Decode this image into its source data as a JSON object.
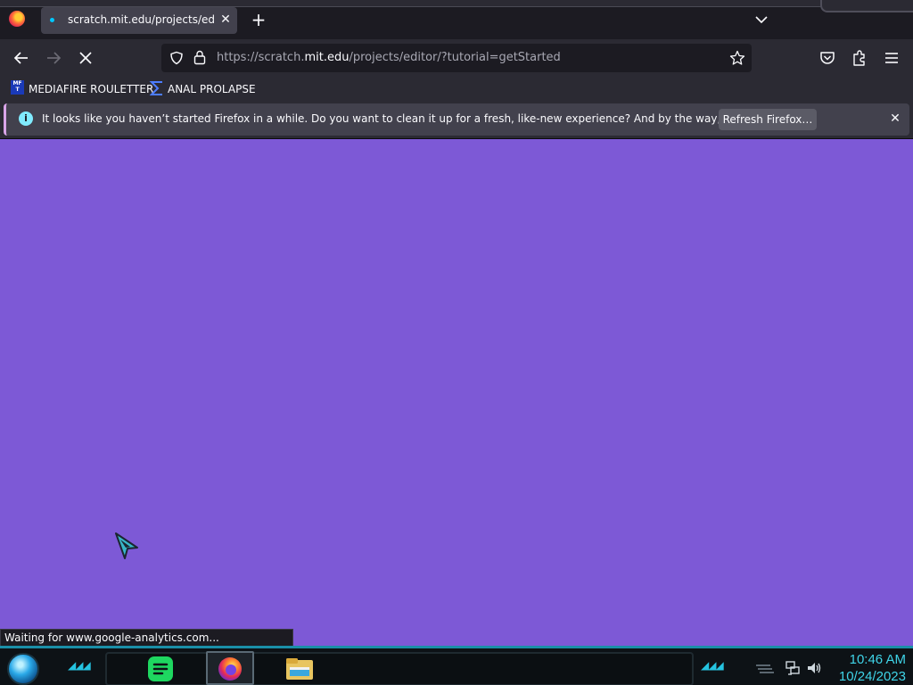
{
  "browser": {
    "tab": {
      "title": "scratch.mit.edu/projects/editor/?tutorial=getStarted",
      "close": "✕"
    },
    "new_tab": "+",
    "url": {
      "scheme": "https://scratch.",
      "host": "mit.edu",
      "path": "/projects/editor/?tutorial=getStarted"
    },
    "bookmarks": [
      {
        "label": "MEDIAFIRE ROULETTER",
        "icon": "mft-icon",
        "icon_text": "MF T"
      },
      {
        "label": "ANAL PROLAPSE",
        "icon": "sigma-icon"
      }
    ],
    "notification": {
      "message": "It looks like you haven’t started Firefox in a while. Do you want to clean it up for a fresh, like-new experience? And by the way, welcome back!",
      "button": "Refresh Firefox…",
      "info_glyph": "i",
      "close": "✕"
    },
    "status": "Waiting for www.google-analytics.com..."
  },
  "page": {
    "background": "#7d59d6"
  },
  "taskbar": {
    "time": "10:46 AM",
    "date": "10/24/2023",
    "apps": [
      {
        "name": "spotify-icon",
        "color": "#1ed760"
      },
      {
        "name": "firefox-icon",
        "active": true
      },
      {
        "name": "file-explorer-icon",
        "color": "#e8c560"
      }
    ],
    "accent": "#25c3e0"
  }
}
